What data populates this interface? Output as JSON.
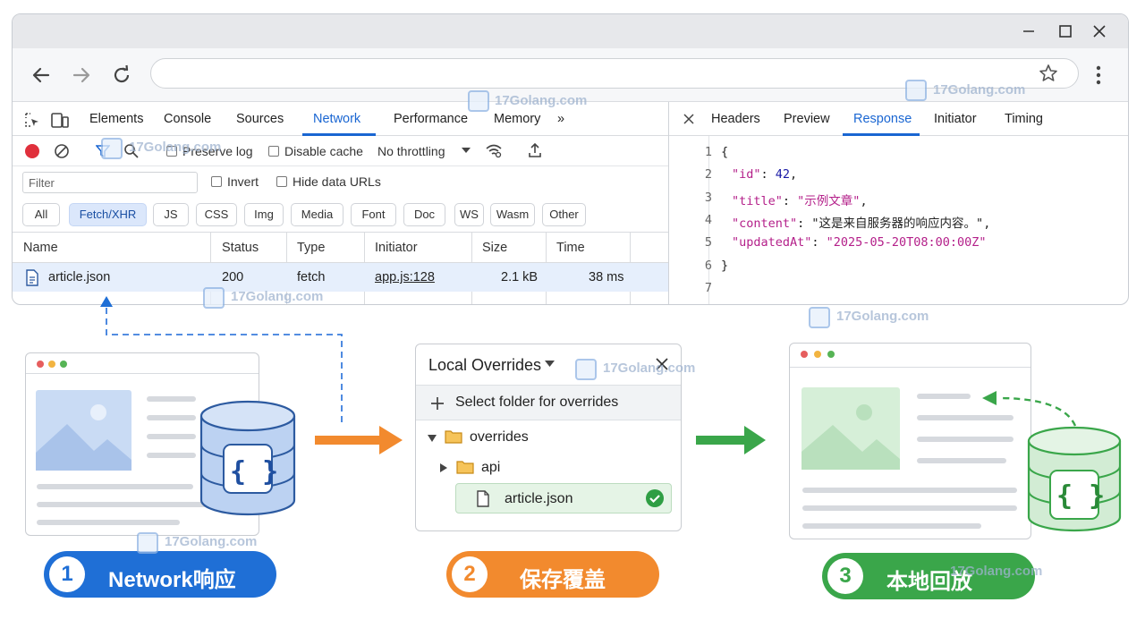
{
  "devtools": {
    "main_tabs": [
      "Elements",
      "Console",
      "Sources",
      "Network",
      "Performance",
      "Memory"
    ],
    "more_tabs_glyph": "»",
    "active_tab": "Network",
    "controls": {
      "preserve_log": "Preserve log",
      "disable_cache": "Disable cache",
      "throttling": "No throttling"
    },
    "filter_placeholder": "Filter",
    "invert": "Invert",
    "hide_data_urls": "Hide data URLs",
    "type_filters": [
      "All",
      "Fetch/XHR",
      "JS",
      "CSS",
      "Img",
      "Media",
      "Font",
      "Doc",
      "WS",
      "Wasm",
      "Other"
    ],
    "active_type_filter": "Fetch/XHR",
    "columns": [
      "Name",
      "Status",
      "Type",
      "Initiator",
      "Size",
      "Time"
    ],
    "rows": [
      {
        "name": "article.json",
        "status": "200",
        "type": "fetch",
        "initiator": "app.js:128",
        "size": "2.1 kB",
        "time": "38 ms"
      }
    ],
    "detail_tabs": [
      "Headers",
      "Preview",
      "Response",
      "Initiator",
      "Timing"
    ],
    "active_detail_tab": "Response",
    "response_lines": [
      {
        "n": "1",
        "text": "{"
      },
      {
        "n": "2",
        "key": "\"id\"",
        "value": "42",
        "kind": "num",
        "trail": ","
      },
      {
        "n": "3",
        "key": "\"title\"",
        "value": "\"示例文章\"",
        "kind": "str",
        "trail": ","
      },
      {
        "n": "4",
        "key": "\"content\"",
        "value": "\"这是来自服务器的响应内容。\"",
        "kind": "plain",
        "trail": ","
      },
      {
        "n": "5",
        "key": "\"updatedAt\"",
        "value": "\"2025-05-20T08:00:00Z\"",
        "kind": "str",
        "trail": ""
      },
      {
        "n": "6",
        "text": "}"
      },
      {
        "n": "7",
        "text": ""
      }
    ]
  },
  "overrides_panel": {
    "title": "Local Overrides",
    "select_folder": "Select folder for overrides",
    "folder_root": "overrides",
    "folder_sub": "api",
    "file": "article.json"
  },
  "steps": [
    {
      "num": "1",
      "label": "Network响应",
      "color": "#1f6fd6"
    },
    {
      "num": "2",
      "label": "保存覆盖",
      "color": "#f28a2e"
    },
    {
      "num": "3",
      "label": "本地回放",
      "color": "#3aa64a"
    }
  ],
  "watermark": "17Golang.com",
  "json_badge": "{ }"
}
